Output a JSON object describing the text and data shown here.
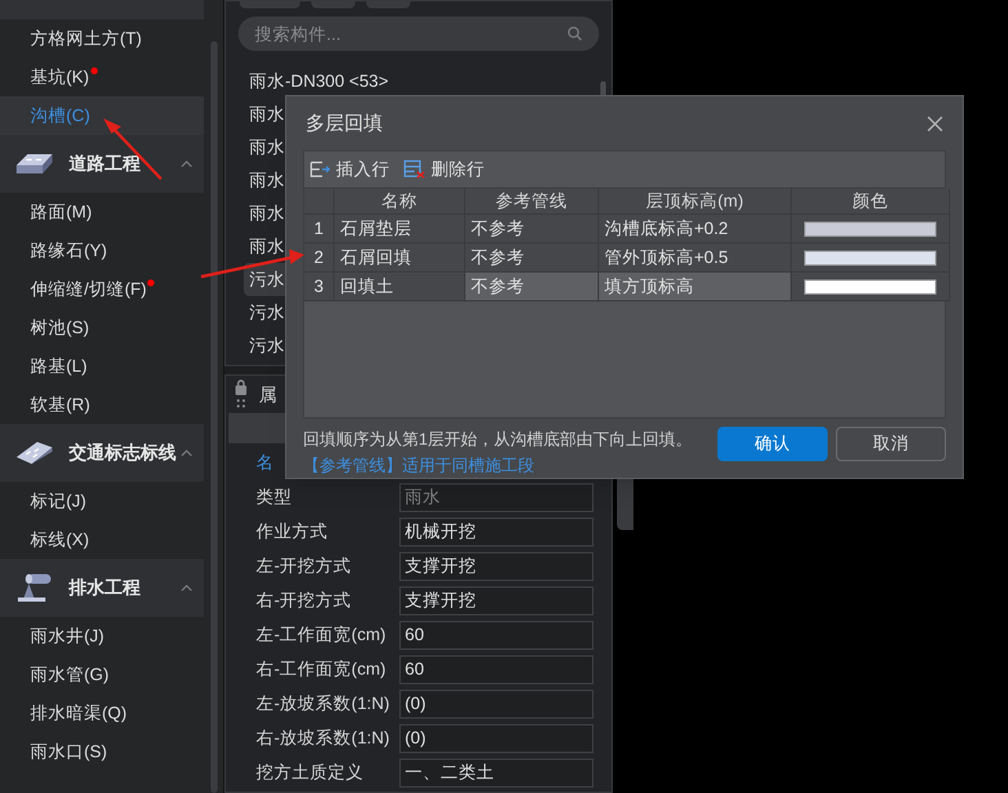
{
  "sidebar": {
    "items": [
      {
        "kind": "item",
        "label": "方格网土方(T)",
        "selected": false,
        "marked": false
      },
      {
        "kind": "item",
        "label": "基坑(K)",
        "selected": false,
        "marked": true
      },
      {
        "kind": "item",
        "label": "沟槽(C)",
        "selected": true,
        "marked": false
      },
      {
        "kind": "group",
        "label": "道路工程",
        "expanded": true
      },
      {
        "kind": "item",
        "label": "路面(M)",
        "selected": false,
        "marked": false
      },
      {
        "kind": "item",
        "label": "路缘石(Y)",
        "selected": false,
        "marked": false
      },
      {
        "kind": "item",
        "label": "伸缩缝/切缝(F)",
        "selected": false,
        "marked": true
      },
      {
        "kind": "item",
        "label": "树池(S)",
        "selected": false,
        "marked": false
      },
      {
        "kind": "item",
        "label": "路基(L)",
        "selected": false,
        "marked": false
      },
      {
        "kind": "item",
        "label": "软基(R)",
        "selected": false,
        "marked": false
      },
      {
        "kind": "group",
        "label": "交通标志标线",
        "expanded": true
      },
      {
        "kind": "item",
        "label": "标记(J)",
        "selected": false,
        "marked": false
      },
      {
        "kind": "item",
        "label": "标线(X)",
        "selected": false,
        "marked": false
      },
      {
        "kind": "group",
        "label": "排水工程",
        "expanded": true
      },
      {
        "kind": "item",
        "label": "雨水井(J)",
        "selected": false,
        "marked": false
      },
      {
        "kind": "item",
        "label": "雨水管(G)",
        "selected": false,
        "marked": false
      },
      {
        "kind": "item",
        "label": "排水暗渠(Q)",
        "selected": false,
        "marked": false
      },
      {
        "kind": "item",
        "label": "雨水口(S)",
        "selected": false,
        "marked": false
      }
    ]
  },
  "components": {
    "search": {
      "placeholder": "搜索构件..."
    },
    "items": [
      {
        "label": "雨水-DN300 <53>",
        "selected": false
      },
      {
        "label": "雨水",
        "selected": false
      },
      {
        "label": "雨水",
        "selected": false
      },
      {
        "label": "雨水",
        "selected": false
      },
      {
        "label": "雨水",
        "selected": false
      },
      {
        "label": "雨水",
        "selected": false
      },
      {
        "label": "污水",
        "selected": true
      },
      {
        "label": "污水",
        "selected": false
      },
      {
        "label": "污水",
        "selected": false
      }
    ]
  },
  "properties": {
    "title": "属",
    "rows": [
      {
        "label": "名",
        "selected": true
      },
      {
        "label": "类型",
        "value": "雨水",
        "disabled": true,
        "selected": false
      },
      {
        "label": "作业方式",
        "value": "机械开挖",
        "disabled": false,
        "selected": false
      },
      {
        "label": "左-开挖方式",
        "value": "支撑开挖",
        "disabled": false,
        "selected": false
      },
      {
        "label": "右-开挖方式",
        "value": "支撑开挖",
        "disabled": false,
        "selected": false
      },
      {
        "label": "左-工作面宽(cm)",
        "value": "60",
        "disabled": false,
        "selected": false
      },
      {
        "label": "右-工作面宽(cm)",
        "value": "60",
        "disabled": false,
        "selected": false
      },
      {
        "label": "左-放坡系数(1:N)",
        "value": "(0)",
        "disabled": false,
        "selected": false
      },
      {
        "label": "右-放坡系数(1:N)",
        "value": "(0)",
        "disabled": false,
        "selected": false
      },
      {
        "label": "挖方土质定义",
        "value": "一、二类土",
        "disabled": false,
        "selected": false
      }
    ]
  },
  "dialog": {
    "title": "多层回填",
    "toolbar": [
      {
        "kind": "insert",
        "label": "插入行"
      },
      {
        "kind": "delete",
        "label": "删除行"
      }
    ],
    "columns": [
      "名称",
      "参考管线",
      "层顶标高(m)",
      "颜色"
    ],
    "rows": [
      {
        "index": "1",
        "name": "石屑垫层",
        "reference": "不参考",
        "top": "沟槽底标高+0.2",
        "color": "#c8cad6",
        "selected": false
      },
      {
        "index": "2",
        "name": "石屑回填",
        "reference": "不参考",
        "top": "管外顶标高+0.5",
        "color": "#dce2ee",
        "selected": false
      },
      {
        "index": "3",
        "name": "回填土",
        "reference": "不参考",
        "top": "填方顶标高",
        "color": "#ffffff",
        "selected": true
      }
    ],
    "note": "回填顺序为从第1层开始，从沟槽底部由下向上回填。",
    "link": "【参考管线】适用于同槽施工段",
    "buttons": [
      {
        "kind": "primary",
        "label": "确认"
      },
      {
        "kind": "secondary",
        "label": "取消"
      }
    ]
  }
}
